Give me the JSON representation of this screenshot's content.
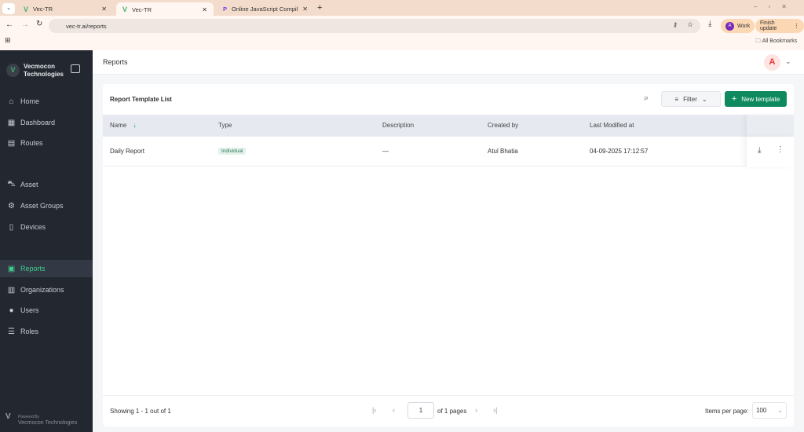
{
  "browser": {
    "tabs": [
      {
        "title": "Vec-TR"
      },
      {
        "title": "Vec-TR",
        "active": true
      },
      {
        "title": "Online JavaScript Compiler (Edi"
      }
    ],
    "url": "vec-tr.ai/reports",
    "profile_label": "Work",
    "profile_initial": "A",
    "update_label": "Finish update",
    "bookmarks_label": "All Bookmarks"
  },
  "sidebar": {
    "brand": "Vecmocon Technologies",
    "items": [
      {
        "label": "Home",
        "icon": "home-icon"
      },
      {
        "label": "Dashboard",
        "icon": "dashboard-icon"
      },
      {
        "label": "Routes",
        "icon": "routes-icon"
      },
      {
        "label": "Asset",
        "icon": "car-icon"
      },
      {
        "label": "Asset Groups",
        "icon": "asset-groups-icon"
      },
      {
        "label": "Devices",
        "icon": "device-icon"
      },
      {
        "label": "Reports",
        "icon": "reports-icon",
        "active": true
      },
      {
        "label": "Organizations",
        "icon": "organizations-icon"
      },
      {
        "label": "Users",
        "icon": "user-icon"
      },
      {
        "label": "Roles",
        "icon": "roles-icon"
      }
    ],
    "powered_by": "Powered By",
    "powered_company": "Vecmocon Technologies"
  },
  "header": {
    "title": "Reports",
    "avatar_initial": "A"
  },
  "card": {
    "title": "Report Template List",
    "filter_label": "Filter",
    "new_template_label": "New template",
    "columns": [
      "Name",
      "Type",
      "Description",
      "Created by",
      "Last Modified at"
    ],
    "rows": [
      {
        "name": "Daily Report",
        "type": "Individual",
        "description": "—",
        "created_by": "Atul Bhatia",
        "modified": "04-09-2025 17:12:57"
      }
    ],
    "footer": {
      "showing": "Showing 1 - 1 out of 1",
      "page": "1",
      "of_pages": "of 1 pages",
      "items_per_page_label": "Items per page:",
      "items_per_page": "100"
    }
  },
  "colors": {
    "accent": "#0f8a5f",
    "sidebar": "#23272f",
    "active_text": "#3ecf8e"
  }
}
